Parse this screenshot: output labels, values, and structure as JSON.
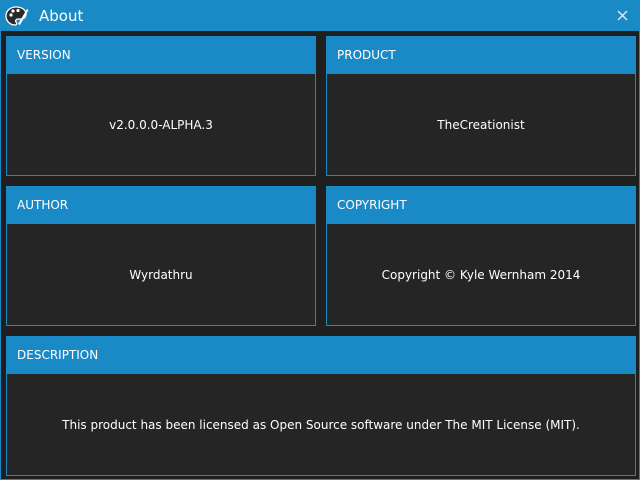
{
  "window": {
    "title": "About",
    "app_icon": "palette-brush-icon",
    "close_icon": "close-icon"
  },
  "panels": {
    "version": {
      "label": "VERSION",
      "value": "v2.0.0.0-ALPHA.3"
    },
    "product": {
      "label": "PRODUCT",
      "value": "TheCreationist"
    },
    "author": {
      "label": "AUTHOR",
      "value": "Wyrdathru"
    },
    "copyright": {
      "label": "COPYRIGHT",
      "value": "Copyright © Kyle Wernham 2014"
    },
    "description": {
      "label": "DESCRIPTION",
      "value": "This product has been licensed as Open Source software under The MIT License (MIT)."
    }
  },
  "colors": {
    "accent": "#1a8ac6",
    "panel_bg": "#252525",
    "window_bg": "#1f1f1f",
    "text": "#ffffff"
  }
}
